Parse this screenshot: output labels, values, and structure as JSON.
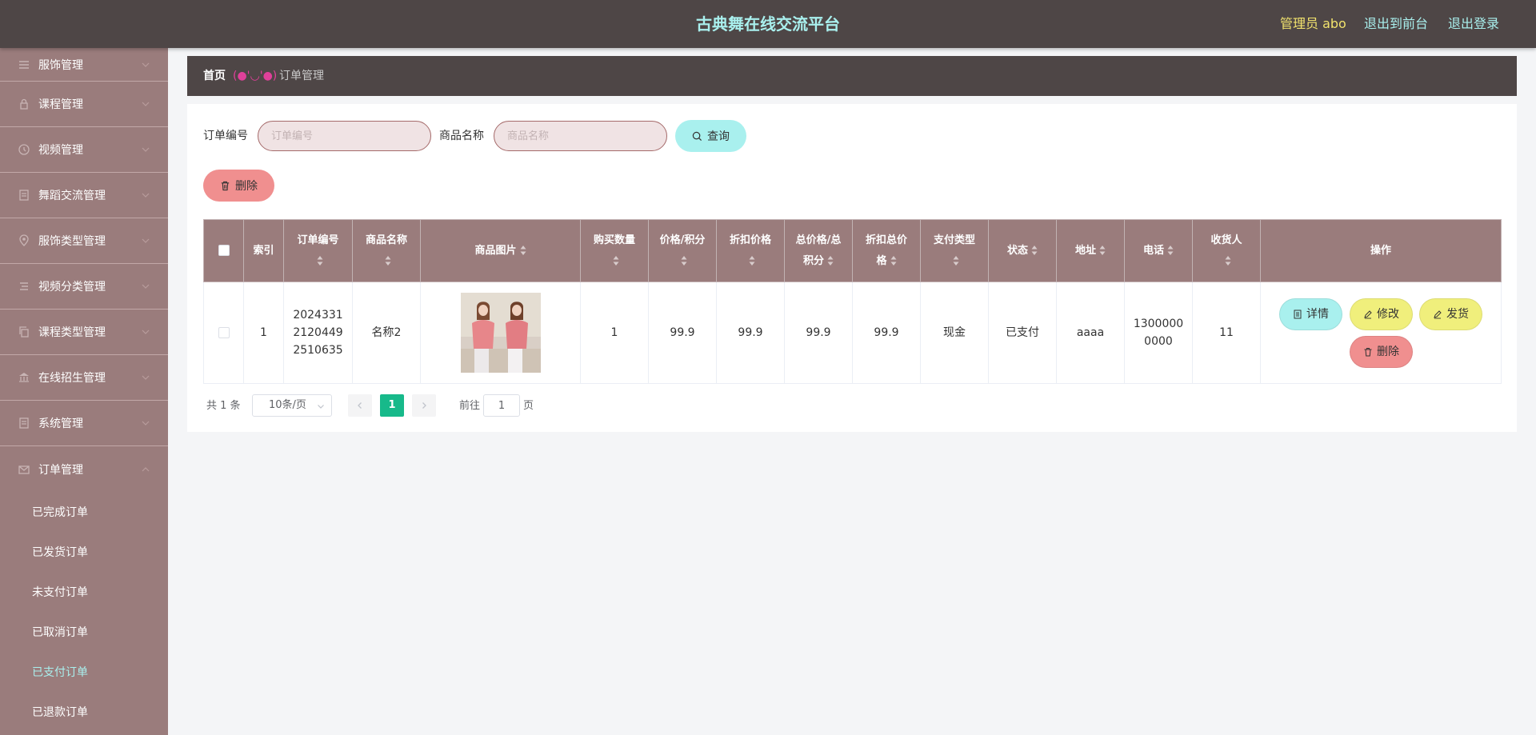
{
  "header": {
    "title": "古典舞在线交流平台",
    "admin_label": "管理员 abo",
    "front_link": "退出到前台",
    "logout_link": "退出登录"
  },
  "sidebar": {
    "menus": [
      {
        "label": "服饰管理",
        "icon": "menu-icon"
      },
      {
        "label": "课程管理",
        "icon": "lock-icon"
      },
      {
        "label": "视频管理",
        "icon": "clock-icon"
      },
      {
        "label": "舞蹈交流管理",
        "icon": "document-icon"
      },
      {
        "label": "服饰类型管理",
        "icon": "location-icon"
      },
      {
        "label": "视频分类管理",
        "icon": "list-icon"
      },
      {
        "label": "课程类型管理",
        "icon": "copy-icon"
      },
      {
        "label": "在线招生管理",
        "icon": "bank-icon"
      },
      {
        "label": "系统管理",
        "icon": "document-icon"
      },
      {
        "label": "订单管理",
        "icon": "mail-icon"
      }
    ],
    "submenu": [
      "已完成订单",
      "已发货订单",
      "未支付订单",
      "已取消订单",
      "已支付订单",
      "已退款订单"
    ],
    "active_submenu": "已支付订单"
  },
  "breadcrumb": {
    "home": "首页",
    "separator": "(●'◡'●)",
    "current": "订单管理"
  },
  "search": {
    "order_no_label": "订单编号",
    "order_no_placeholder": "订单编号",
    "product_name_label": "商品名称",
    "product_name_placeholder": "商品名称",
    "query_button": "查询",
    "batch_delete_button": "删除"
  },
  "table": {
    "headers": {
      "index": "索引",
      "order_no": "订单编号",
      "product_name": "商品名称",
      "product_image": "商品图片",
      "quantity": "购买数量",
      "price": "价格/积分",
      "discount_price": "折扣价格",
      "total_price_a": "总价格/总",
      "total_price_b": "积分",
      "discount_total_a": "折扣总价",
      "discount_total_b": "格",
      "pay_type": "支付类型",
      "status": "状态",
      "address": "地址",
      "phone": "电话",
      "receiver": "收货人",
      "actions": "操作"
    },
    "rows": [
      {
        "index": "1",
        "order_no_lines": [
          "2024331",
          "2120449",
          "2510635"
        ],
        "product_name": "名称2",
        "quantity": "1",
        "price": "99.9",
        "discount_price": "99.9",
        "total_price": "99.9",
        "discount_total": "99.9",
        "pay_type": "现金",
        "status": "已支付",
        "address": "aaaa",
        "phone_lines": [
          "1300000",
          "0000"
        ],
        "receiver": "11",
        "actions": {
          "detail": "详情",
          "edit": "修改",
          "ship": "发货",
          "delete": "删除"
        }
      }
    ]
  },
  "pagination": {
    "total": "共 1 条",
    "page_size": "10条/页",
    "current_page": "1",
    "goto_label": "前往",
    "goto_value": "1",
    "page_suffix": "页"
  },
  "colors": {
    "header_bg": "#4e4646",
    "sidebar_bg": "#9a7c7c",
    "accent_cyan": "#a9f0ee",
    "accent_yellow": "#f0ef7c",
    "accent_red": "#f08f8f",
    "page_active": "#17b98a"
  }
}
